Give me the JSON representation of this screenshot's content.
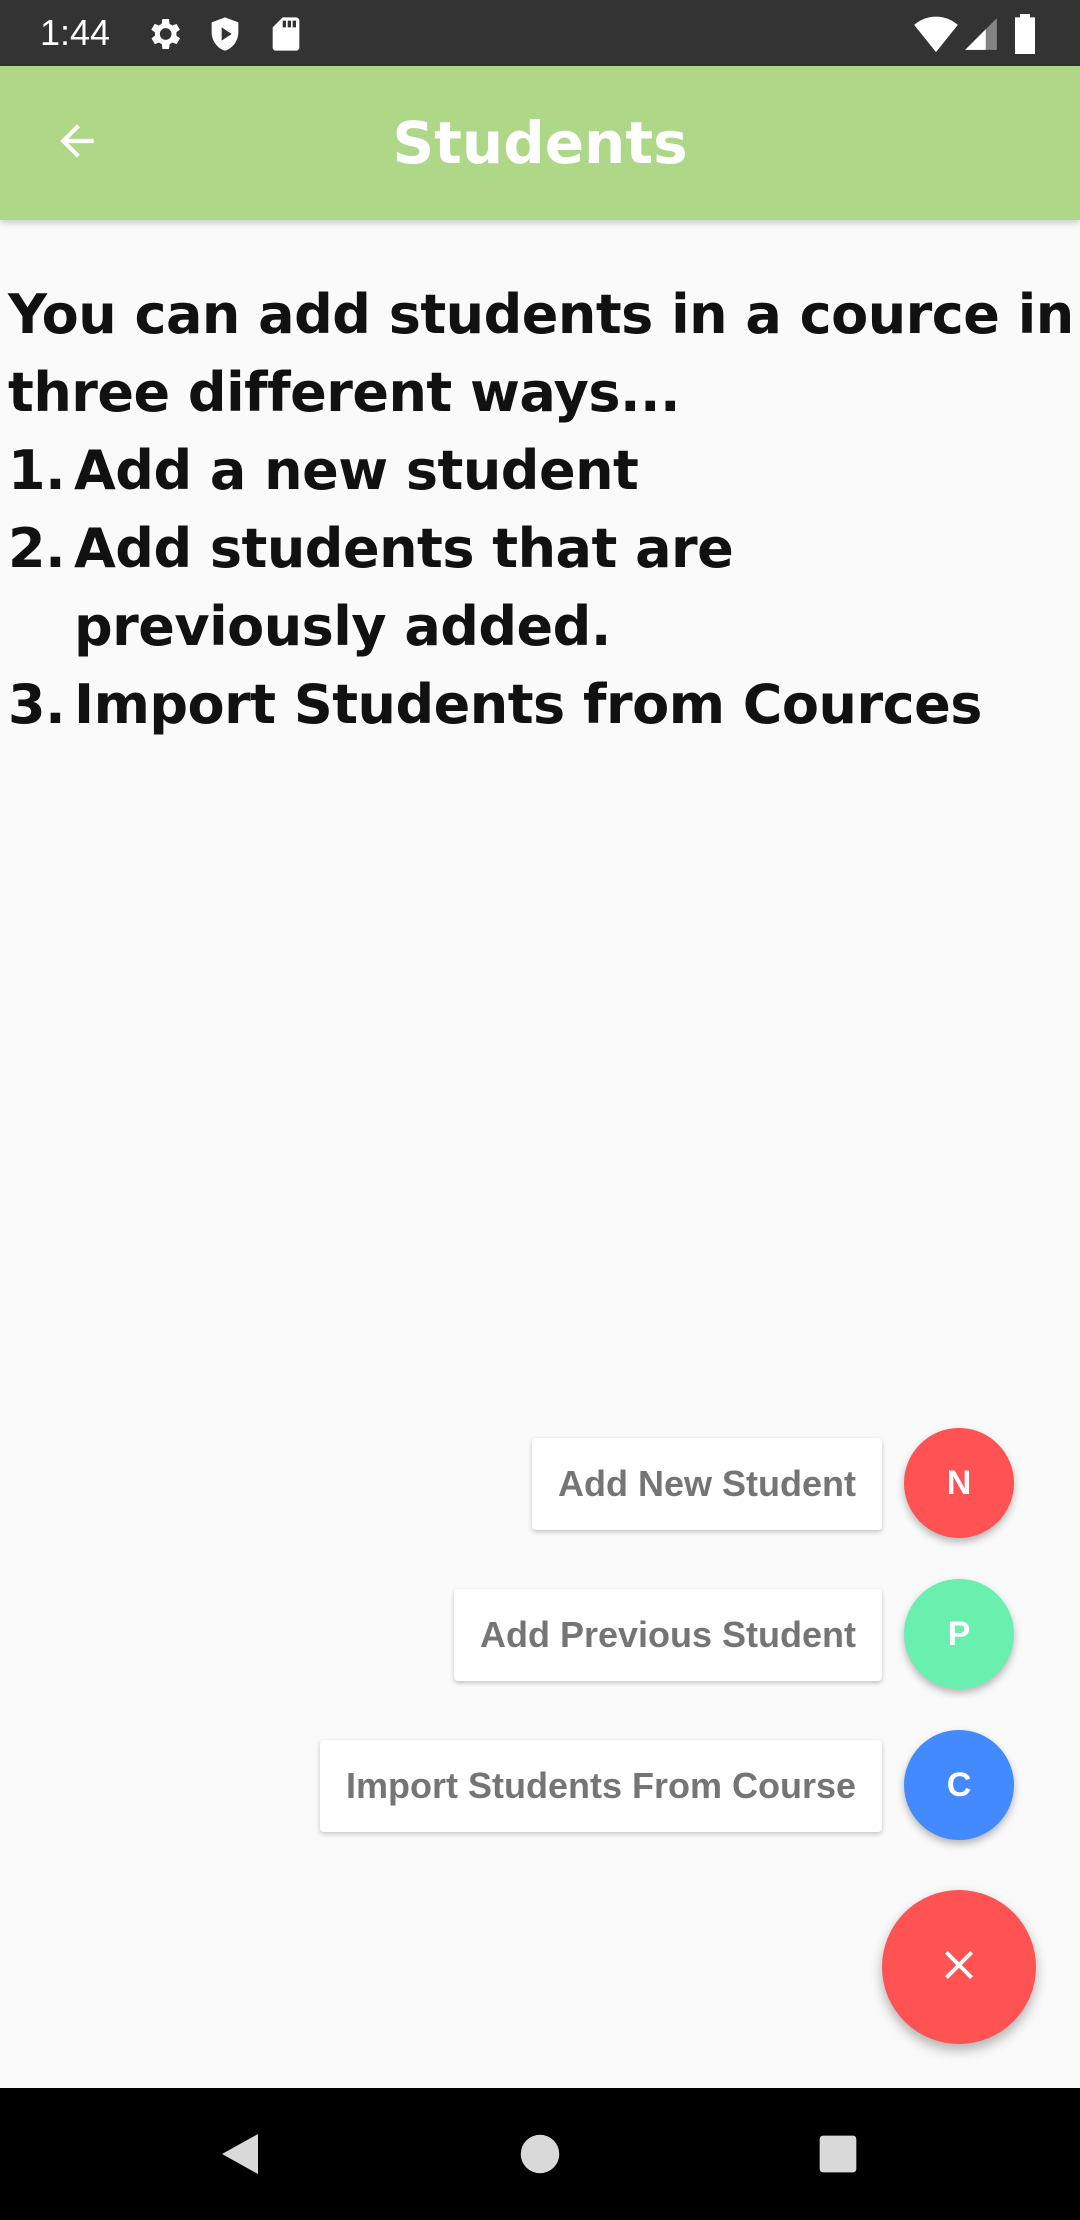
{
  "status_bar": {
    "time": "1:44",
    "left_icons": [
      "gear-icon",
      "shield-play-icon",
      "sd-card-icon"
    ],
    "right_icons": [
      "wifi-icon",
      "signal-icon",
      "battery-icon"
    ]
  },
  "app_bar": {
    "title": "Students",
    "back_icon": "arrow-left-icon",
    "background_color": "#afd788"
  },
  "description": {
    "intro_line1": "You can add students in a cource in",
    "intro_line2": "three different ways...",
    "items": [
      {
        "num": "1.",
        "text": "Add a new student"
      },
      {
        "num": "2.",
        "text": "Add students that are previously added."
      },
      {
        "num": "3.",
        "text": "Import Students from Cources"
      }
    ]
  },
  "speed_dial": {
    "actions": [
      {
        "label": "Add New Student",
        "fab_text": "N",
        "color": "#ff5252"
      },
      {
        "label": "Add Previous Student",
        "fab_text": "P",
        "color": "#69f0ae"
      },
      {
        "label": "Import Students From Course",
        "fab_text": "C",
        "color": "#448aff"
      }
    ],
    "main_fab": {
      "icon": "close-icon",
      "color": "#ff5252"
    }
  },
  "nav_bar": {
    "buttons": [
      "back-triangle-icon",
      "home-circle-icon",
      "recents-square-icon"
    ]
  }
}
